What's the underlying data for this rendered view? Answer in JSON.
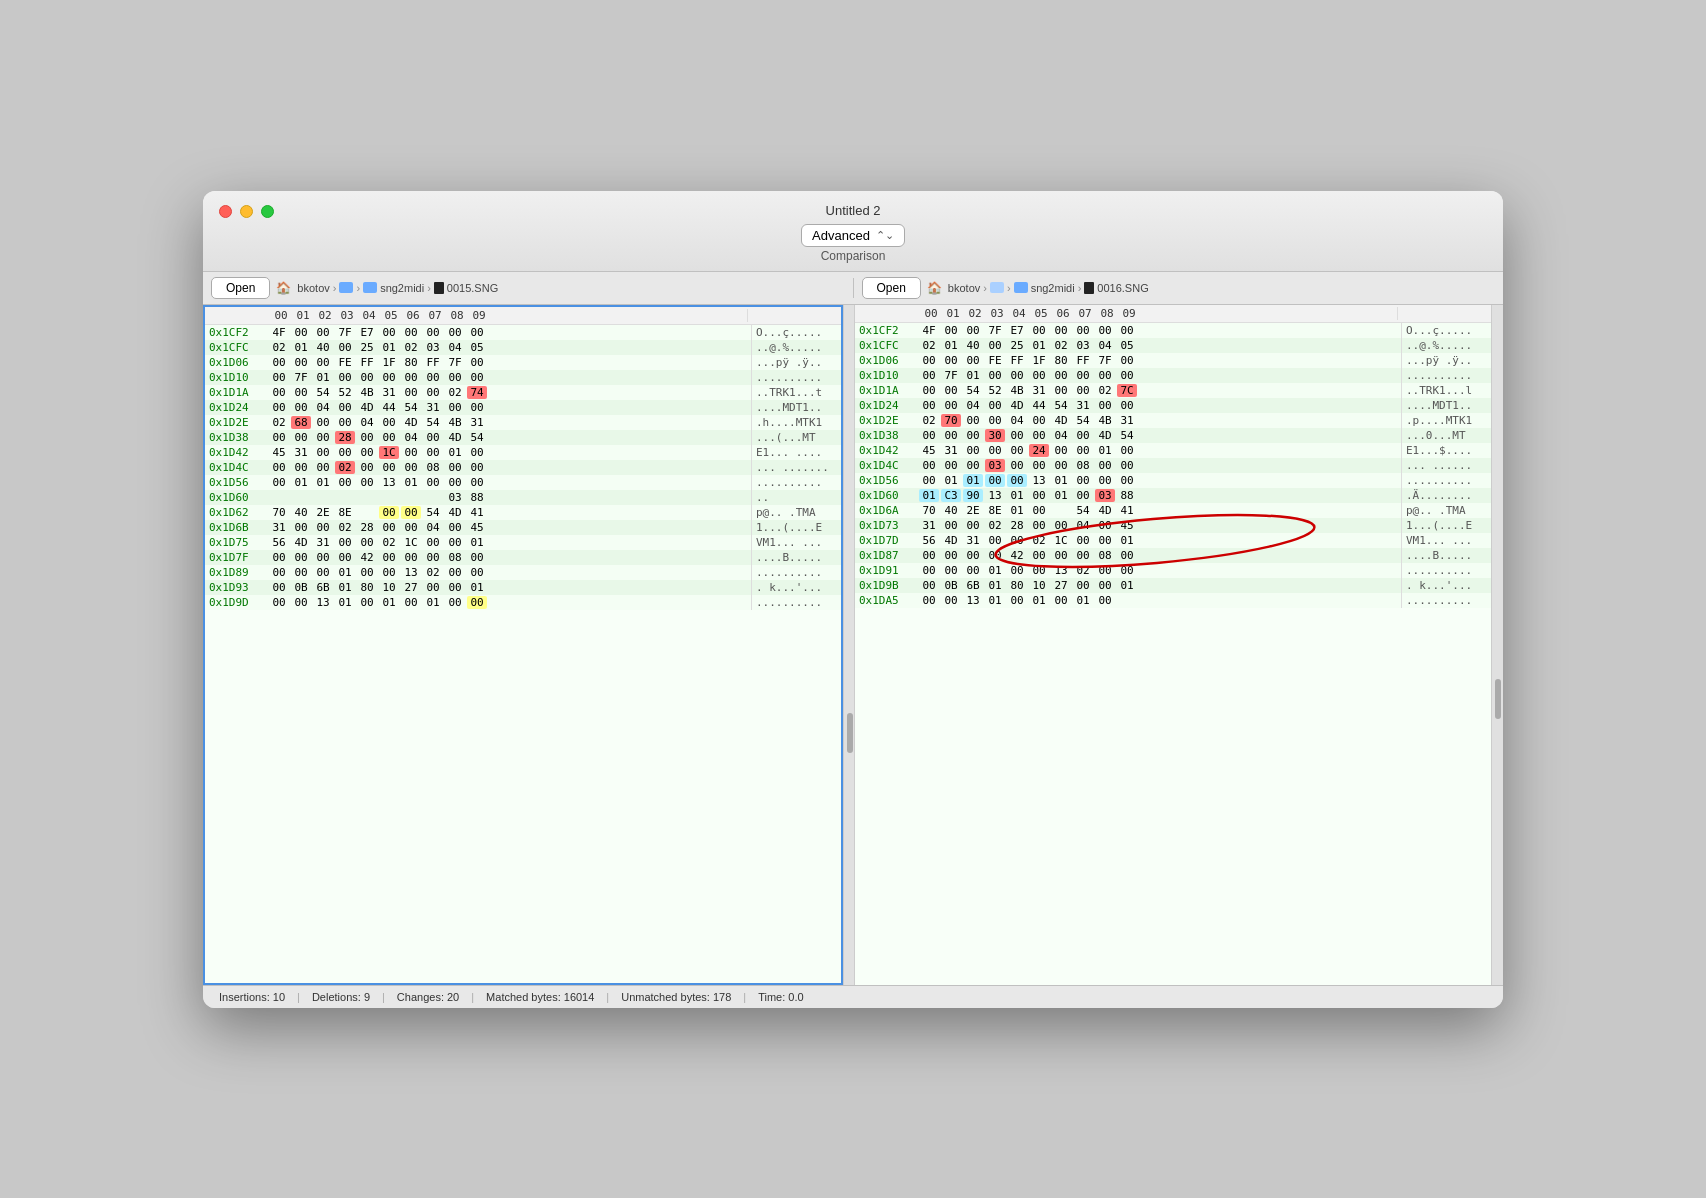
{
  "window": {
    "title": "Untitled 2",
    "mode": "Advanced",
    "comparison_label": "Comparison"
  },
  "toolbar_left": {
    "open_label": "Open",
    "breadcrumb": [
      "🏠 bkotov",
      ">",
      "📁",
      ">",
      "📁 sng2midi",
      ">",
      "■ 0015.SNG"
    ]
  },
  "toolbar_right": {
    "open_label": "Open",
    "breadcrumb": [
      "🏠 bkotov",
      ">",
      "📁 □",
      ">",
      "📁 sng2midi",
      ">",
      "■ 0016.SNG"
    ]
  },
  "col_headers": [
    "00",
    "01",
    "02",
    "03",
    "04",
    "05",
    "06",
    "07",
    "08",
    "09"
  ],
  "left_rows": [
    {
      "addr": "0x1CF2",
      "bytes": [
        "4F",
        "00",
        "00",
        "7F",
        "E7",
        "00",
        "00",
        "00",
        "00",
        "00"
      ],
      "ascii": "O...ç.....",
      "classes": [
        "",
        "",
        "",
        "",
        "",
        "",
        "",
        "",
        "",
        ""
      ]
    },
    {
      "addr": "0x1CFC",
      "bytes": [
        "02",
        "01",
        "40",
        "00",
        "25",
        "01",
        "02",
        "03",
        "04",
        "05"
      ],
      "ascii": "..@.%.....",
      "classes": [
        "",
        "",
        "",
        "",
        "",
        "",
        "",
        "",
        "",
        ""
      ]
    },
    {
      "addr": "0x1D06",
      "bytes": [
        "00",
        "00",
        "00",
        "FE",
        "FF",
        "1F",
        "80",
        "FF",
        "7F",
        "00"
      ],
      "ascii": "...pÿ .ÿ..",
      "classes": [
        "",
        "",
        "",
        "",
        "",
        "",
        "",
        "",
        "",
        ""
      ]
    },
    {
      "addr": "0x1D10",
      "bytes": [
        "00",
        "7F",
        "01",
        "00",
        "00",
        "00",
        "00",
        "00",
        "00",
        "00"
      ],
      "ascii": "..........",
      "classes": [
        "",
        "",
        "",
        "",
        "",
        "",
        "",
        "",
        "",
        ""
      ]
    },
    {
      "addr": "0x1D1A",
      "bytes": [
        "00",
        "00",
        "54",
        "52",
        "4B",
        "31",
        "00",
        "00",
        "02",
        "74"
      ],
      "ascii": "..TRK1...t",
      "classes": [
        "",
        "",
        "",
        "",
        "",
        "",
        "",
        "",
        "",
        "ins"
      ]
    },
    {
      "addr": "0x1D24",
      "bytes": [
        "00",
        "00",
        "04",
        "00",
        "4D",
        "44",
        "54",
        "31",
        "00",
        "00"
      ],
      "ascii": "....MDT1..",
      "classes": [
        "",
        "",
        "",
        "",
        "",
        "",
        "",
        "",
        "",
        ""
      ]
    },
    {
      "addr": "0x1D2E",
      "bytes": [
        "02",
        "68",
        "00",
        "00",
        "04",
        "00",
        "4D",
        "54",
        "4B",
        "31"
      ],
      "ascii": ".h....MTK1",
      "classes": [
        "",
        "ins",
        "",
        "",
        "",
        "",
        "",
        "",
        "",
        ""
      ]
    },
    {
      "addr": "0x1D38",
      "bytes": [
        "00",
        "00",
        "00",
        "28",
        "00",
        "00",
        "04",
        "00",
        "4D",
        "54"
      ],
      "ascii": "...(...MT",
      "classes": [
        "",
        "",
        "",
        "ins",
        "",
        "",
        "",
        "",
        "",
        ""
      ]
    },
    {
      "addr": "0x1D42",
      "bytes": [
        "45",
        "31",
        "00",
        "00",
        "00",
        "1C",
        "00",
        "00",
        "01",
        "00"
      ],
      "ascii": "E1... ....",
      "classes": [
        "",
        "",
        "",
        "",
        "",
        "ins",
        "",
        "",
        "",
        ""
      ]
    },
    {
      "addr": "0x1D4C",
      "bytes": [
        "00",
        "00",
        "00",
        "02",
        "00",
        "00",
        "00",
        "08",
        "00",
        "00"
      ],
      "ascii": "... .......",
      "classes": [
        "",
        "",
        "",
        "ins",
        "",
        "",
        "",
        "",
        "",
        ""
      ]
    },
    {
      "addr": "0x1D56",
      "bytes": [
        "00",
        "01",
        "01",
        "00",
        "00",
        "13",
        "01",
        "00",
        "00",
        "00"
      ],
      "ascii": "..........",
      "classes": [
        "",
        "",
        "",
        "",
        "",
        "",
        "",
        "",
        "",
        ""
      ]
    },
    {
      "addr": "0x1D60",
      "bytes": [
        "",
        "",
        "",
        "",
        "",
        "",
        "",
        "",
        "03",
        "88"
      ],
      "ascii": "..",
      "classes": [
        "empty",
        "empty",
        "empty",
        "empty",
        "empty",
        "empty",
        "empty",
        "empty",
        "",
        ""
      ]
    },
    {
      "addr": "0x1D62",
      "bytes": [
        "70",
        "40",
        "2E",
        "8E",
        "",
        "00",
        "00",
        "54",
        "4D",
        "41"
      ],
      "ascii": "p@.. .TMA",
      "classes": [
        "",
        "",
        "",
        "",
        "empty",
        "yellow",
        "yellow",
        "",
        "",
        ""
      ]
    },
    {
      "addr": "0x1D6B",
      "bytes": [
        "31",
        "00",
        "00",
        "02",
        "28",
        "00",
        "00",
        "04",
        "00",
        "45"
      ],
      "ascii": "1...(....E",
      "classes": [
        "",
        "",
        "",
        "",
        "",
        "",
        "",
        "",
        "",
        ""
      ]
    },
    {
      "addr": "0x1D75",
      "bytes": [
        "56",
        "4D",
        "31",
        "00",
        "00",
        "02",
        "1C",
        "00",
        "00",
        "01"
      ],
      "ascii": "VM1... ...",
      "classes": [
        "",
        "",
        "",
        "",
        "",
        "",
        "",
        "",
        "",
        ""
      ]
    },
    {
      "addr": "0x1D7F",
      "bytes": [
        "00",
        "00",
        "00",
        "00",
        "42",
        "00",
        "00",
        "00",
        "08",
        "00"
      ],
      "ascii": "....B.....",
      "classes": [
        "",
        "",
        "",
        "",
        "",
        "",
        "",
        "",
        "",
        ""
      ]
    },
    {
      "addr": "0x1D89",
      "bytes": [
        "00",
        "00",
        "00",
        "01",
        "00",
        "00",
        "13",
        "02",
        "00",
        "00"
      ],
      "ascii": "..........",
      "classes": [
        "",
        "",
        "",
        "",
        "",
        "",
        "",
        "",
        "",
        ""
      ]
    },
    {
      "addr": "0x1D93",
      "bytes": [
        "00",
        "0B",
        "6B",
        "01",
        "80",
        "10",
        "27",
        "00",
        "00",
        "01"
      ],
      "ascii": ". k...'...",
      "classes": [
        "",
        "",
        "",
        "",
        "",
        "",
        "",
        "",
        "",
        ""
      ]
    },
    {
      "addr": "0x1D9D",
      "bytes": [
        "00",
        "00",
        "13",
        "01",
        "00",
        "01",
        "00",
        "01",
        "00",
        "00"
      ],
      "ascii": "..........",
      "classes": [
        "",
        "",
        "",
        "",
        "",
        "",
        "",
        "",
        "",
        "yellow"
      ]
    }
  ],
  "right_rows": [
    {
      "addr": "0x1CF2",
      "bytes": [
        "4F",
        "00",
        "00",
        "7F",
        "E7",
        "00",
        "00",
        "00",
        "00",
        "00"
      ],
      "ascii": "O...ç.....",
      "classes": [
        "",
        "",
        "",
        "",
        "",
        "",
        "",
        "",
        "",
        ""
      ]
    },
    {
      "addr": "0x1CFC",
      "bytes": [
        "02",
        "01",
        "40",
        "00",
        "25",
        "01",
        "02",
        "03",
        "04",
        "05"
      ],
      "ascii": "..@.%.....",
      "classes": [
        "",
        "",
        "",
        "",
        "",
        "",
        "",
        "",
        "",
        ""
      ]
    },
    {
      "addr": "0x1D06",
      "bytes": [
        "00",
        "00",
        "00",
        "FE",
        "FF",
        "1F",
        "80",
        "FF",
        "7F",
        "00"
      ],
      "ascii": "...pÿ .ÿ..",
      "classes": [
        "",
        "",
        "",
        "",
        "",
        "",
        "",
        "",
        "",
        ""
      ]
    },
    {
      "addr": "0x1D10",
      "bytes": [
        "00",
        "7F",
        "01",
        "00",
        "00",
        "00",
        "00",
        "00",
        "00",
        "00"
      ],
      "ascii": "..........",
      "classes": [
        "",
        "",
        "",
        "",
        "",
        "",
        "",
        "",
        "",
        ""
      ]
    },
    {
      "addr": "0x1D1A",
      "bytes": [
        "00",
        "00",
        "54",
        "52",
        "4B",
        "31",
        "00",
        "00",
        "02",
        "7C"
      ],
      "ascii": "..TRK1...l",
      "classes": [
        "",
        "",
        "",
        "",
        "",
        "",
        "",
        "",
        "",
        "ins"
      ]
    },
    {
      "addr": "0x1D24",
      "bytes": [
        "00",
        "00",
        "04",
        "00",
        "4D",
        "44",
        "54",
        "31",
        "00",
        "00"
      ],
      "ascii": "....MDT1..",
      "classes": [
        "",
        "",
        "",
        "",
        "",
        "",
        "",
        "",
        "",
        ""
      ]
    },
    {
      "addr": "0x1D2E",
      "bytes": [
        "02",
        "70",
        "00",
        "00",
        "04",
        "00",
        "4D",
        "54",
        "4B",
        "31"
      ],
      "ascii": ".p....MTK1",
      "classes": [
        "",
        "ins",
        "",
        "",
        "",
        "",
        "",
        "",
        "",
        ""
      ]
    },
    {
      "addr": "0x1D38",
      "bytes": [
        "00",
        "00",
        "00",
        "30",
        "00",
        "00",
        "04",
        "00",
        "4D",
        "54"
      ],
      "ascii": "...0...MT",
      "classes": [
        "",
        "",
        "",
        "ins",
        "",
        "",
        "",
        "",
        "",
        ""
      ]
    },
    {
      "addr": "0x1D42",
      "bytes": [
        "45",
        "31",
        "00",
        "00",
        "00",
        "24",
        "00",
        "00",
        "01",
        "00"
      ],
      "ascii": "E1...$....",
      "classes": [
        "",
        "",
        "",
        "",
        "",
        "ins",
        "",
        "",
        "",
        ""
      ]
    },
    {
      "addr": "0x1D4C",
      "bytes": [
        "00",
        "00",
        "00",
        "03",
        "00",
        "00",
        "00",
        "08",
        "00",
        "00"
      ],
      "ascii": "... ......",
      "classes": [
        "",
        "",
        "",
        "ins",
        "",
        "",
        "",
        "",
        "",
        ""
      ]
    },
    {
      "addr": "0x1D56",
      "bytes": [
        "00",
        "01",
        "01",
        "00",
        "00",
        "13",
        "01",
        "00",
        "00",
        "00"
      ],
      "ascii": "..........",
      "classes": [
        "",
        "",
        "cyan",
        "cyan",
        "cyan",
        "",
        "",
        "",
        "",
        ""
      ]
    },
    {
      "addr": "0x1D60",
      "bytes": [
        "01",
        "C3",
        "90",
        "13",
        "01",
        "00",
        "01",
        "00",
        "03",
        "88"
      ],
      "ascii": ".Ä........",
      "classes": [
        "cyan",
        "cyan",
        "cyan",
        "",
        "",
        "",
        "",
        "",
        "ins",
        ""
      ]
    },
    {
      "addr": "0x1D6A",
      "bytes": [
        "70",
        "40",
        "2E",
        "8E",
        "01",
        "00",
        "",
        "54",
        "4D",
        "41"
      ],
      "ascii": "p@.. .TMA",
      "classes": [
        "",
        "",
        "",
        "",
        "",
        "",
        "empty",
        "",
        "",
        ""
      ]
    },
    {
      "addr": "0x1D73",
      "bytes": [
        "31",
        "00",
        "00",
        "02",
        "28",
        "00",
        "00",
        "04",
        "00",
        "45"
      ],
      "ascii": "1...(....E",
      "classes": [
        "",
        "",
        "",
        "",
        "",
        "",
        "",
        "",
        "",
        ""
      ]
    },
    {
      "addr": "0x1D7D",
      "bytes": [
        "56",
        "4D",
        "31",
        "00",
        "00",
        "02",
        "1C",
        "00",
        "00",
        "01"
      ],
      "ascii": "VM1... ...",
      "classes": [
        "",
        "",
        "",
        "",
        "",
        "",
        "",
        "",
        "",
        ""
      ]
    },
    {
      "addr": "0x1D87",
      "bytes": [
        "00",
        "00",
        "00",
        "00",
        "42",
        "00",
        "00",
        "00",
        "08",
        "00"
      ],
      "ascii": "....B.....",
      "classes": [
        "",
        "",
        "",
        "",
        "",
        "",
        "",
        "",
        "",
        ""
      ]
    },
    {
      "addr": "0x1D91",
      "bytes": [
        "00",
        "00",
        "00",
        "01",
        "00",
        "00",
        "13",
        "02",
        "00",
        "00"
      ],
      "ascii": "..........",
      "classes": [
        "",
        "",
        "",
        "",
        "",
        "",
        "",
        "",
        "",
        ""
      ]
    },
    {
      "addr": "0x1D9B",
      "bytes": [
        "00",
        "0B",
        "6B",
        "01",
        "80",
        "10",
        "27",
        "00",
        "00",
        "01"
      ],
      "ascii": ". k...'...",
      "classes": [
        "",
        "",
        "",
        "",
        "",
        "",
        "",
        "",
        "",
        ""
      ]
    },
    {
      "addr": "0x1DA5",
      "bytes": [
        "00",
        "00",
        "13",
        "01",
        "00",
        "01",
        "00",
        "01",
        "00",
        ""
      ],
      "ascii": "..........",
      "classes": [
        "",
        "",
        "",
        "",
        "",
        "",
        "",
        "",
        "",
        ""
      ]
    }
  ],
  "statusbar": {
    "insertions": "Insertions: 10",
    "deletions": "Deletions: 9",
    "changes": "Changes: 20",
    "matched": "Matched bytes: 16014",
    "unmatched": "Unmatched bytes: 178",
    "time": "Time: 0.0"
  }
}
